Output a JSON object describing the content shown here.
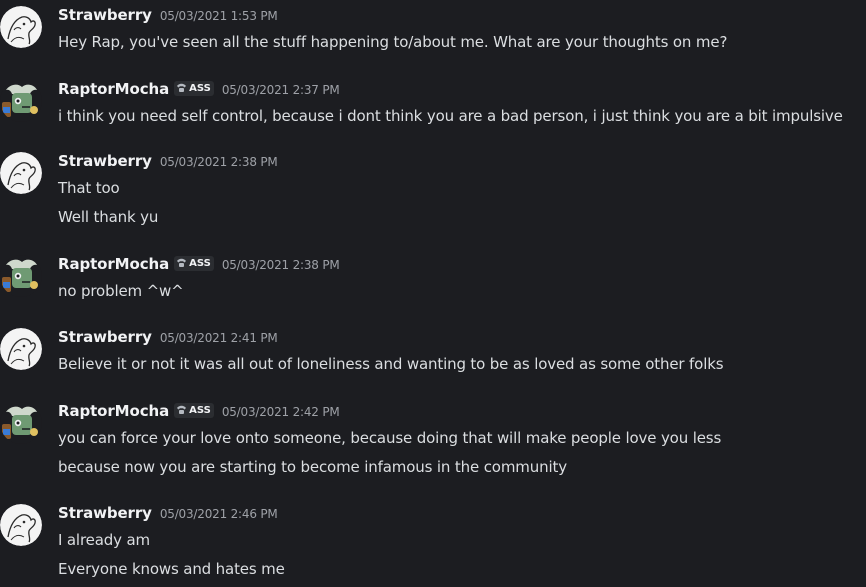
{
  "colors": {
    "background": "#1c1d21",
    "username": "#f2f3f5",
    "timestamp": "#9ea1a7",
    "message_text": "#dbdee1",
    "tag_background": "#2b2d31"
  },
  "messages": [
    {
      "author": "Strawberry",
      "avatar": "strawberry-avatar",
      "tag": null,
      "timestamp": "05/03/2021 1:53 PM",
      "lines": [
        "Hey Rap, you've seen all the stuff happening to/about me. What are your thoughts on me?"
      ]
    },
    {
      "author": "RaptorMocha",
      "avatar": "raptormocha-avatar",
      "tag": "ASS",
      "tag_icon": "phone-icon",
      "timestamp": "05/03/2021 2:37 PM",
      "lines": [
        "i think you need self control, because i dont think you are a bad person, i just think you are a bit impulsive"
      ]
    },
    {
      "author": "Strawberry",
      "avatar": "strawberry-avatar",
      "tag": null,
      "timestamp": "05/03/2021 2:38 PM",
      "lines": [
        "That too",
        "Well thank yu"
      ]
    },
    {
      "author": "RaptorMocha",
      "avatar": "raptormocha-avatar",
      "tag": "ASS",
      "tag_icon": "phone-icon",
      "timestamp": "05/03/2021 2:38 PM",
      "lines": [
        "no problem ^w^"
      ]
    },
    {
      "author": "Strawberry",
      "avatar": "strawberry-avatar",
      "tag": null,
      "timestamp": "05/03/2021 2:41 PM",
      "lines": [
        "Believe it or not it was all out of loneliness and wanting to be as loved as some other folks"
      ]
    },
    {
      "author": "RaptorMocha",
      "avatar": "raptormocha-avatar",
      "tag": "ASS",
      "tag_icon": "phone-icon",
      "timestamp": "05/03/2021 2:42 PM",
      "lines": [
        "you can force your love onto someone, because doing that will make people love you less",
        "because now you are starting to become infamous in the community"
      ]
    },
    {
      "author": "Strawberry",
      "avatar": "strawberry-avatar",
      "tag": null,
      "timestamp": "05/03/2021 2:46 PM",
      "lines": [
        "I already am",
        "Everyone knows and hates me"
      ]
    }
  ]
}
